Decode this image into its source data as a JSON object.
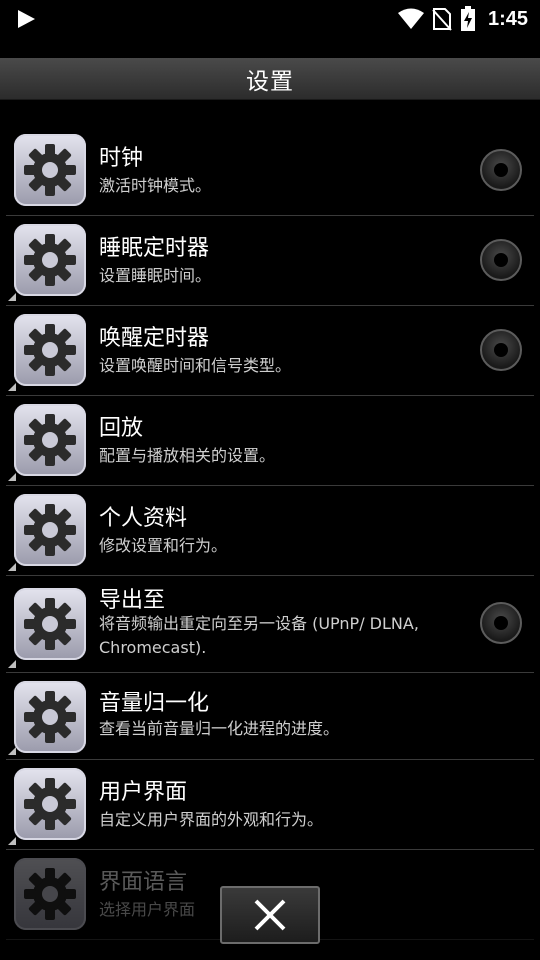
{
  "status_bar": {
    "time": "1:45",
    "icons": [
      "play-icon",
      "wifi-icon",
      "no-sim-icon",
      "battery-charging-icon"
    ]
  },
  "header": {
    "title": "设置"
  },
  "settings": [
    {
      "label": "时钟",
      "desc": "激活时钟模式。",
      "has_radio": true
    },
    {
      "label": "睡眠定时器",
      "desc": "设置睡眠时间。",
      "has_radio": true
    },
    {
      "label": "唤醒定时器",
      "desc": "设置唤醒时间和信号类型。",
      "has_radio": true
    },
    {
      "label": "回放",
      "desc": "配置与播放相关的设置。",
      "has_radio": false
    },
    {
      "label": "个人资料",
      "desc": "修改设置和行为。",
      "has_radio": false
    },
    {
      "label": "导出至",
      "desc": "将音频输出重定向至另一设备 (UPnP/ DLNA, Chromecast).",
      "has_radio": true
    },
    {
      "label": "音量归一化",
      "desc": "查看当前音量归一化进程的进度。",
      "has_radio": false
    },
    {
      "label": "用户界面",
      "desc": "自定义用户界面的外观和行为。",
      "has_radio": false
    },
    {
      "label": "界面语言",
      "desc": "选择用户界面",
      "has_radio": false
    }
  ],
  "close_button": {
    "icon": "close-icon"
  }
}
